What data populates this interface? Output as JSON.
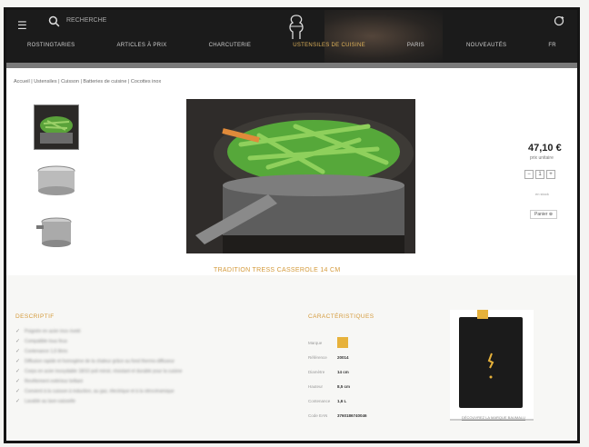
{
  "header": {
    "search_placeholder": "RECHERCHE",
    "nav": [
      "ROSTINGTARIES",
      "ARTICLES À PRIX",
      "CHARCUTERIE",
      "USTENSILES DE CUISINE",
      "PARIS",
      "NOUVEAUTÉS",
      "FR"
    ]
  },
  "breadcrumb": "Accueil | Ustensiles | Cuisson | Batteries de cuisine | Cocottes inox",
  "product": {
    "name": "TRADITION TRESS CASSEROLE 14 CM",
    "price": "47,10 €",
    "price_sub": "prix unitaire",
    "qty": "1",
    "stock": "en stock",
    "cart_label": "Panier ⊕"
  },
  "description": {
    "heading": "DESCRIPTIF",
    "items": [
      "Poignée en acier inox riveté",
      "Compatible tous feux",
      "Contenance 1,6 litres",
      "Diffusion rapide et homogène de la chaleur grâce au fond thermo-diffuseur",
      "Corps en acier inoxydable 18/10 poli miroir, résistant et durable pour la cuisine",
      "Revêtement extérieur brillant",
      "Convient à la cuisson à induction, au gaz, électrique et à la vitrocéramique",
      "Lavable au lave-vaisselle"
    ]
  },
  "specs": {
    "heading": "CARACTÉRISTIQUES",
    "rows": [
      {
        "k": "Marque",
        "v": ""
      },
      {
        "k": "Référence",
        "v": "20014"
      },
      {
        "k": "Diamètre",
        "v": "14 cm"
      },
      {
        "k": "Hauteur",
        "v": "8,5 cm"
      },
      {
        "k": "Contenance",
        "v": "1,6 L"
      },
      {
        "k": "Code EAN",
        "v": "3760186740046"
      }
    ]
  },
  "brand_caption": "DÉCOUVREZ LA MARQUE BAUMALU",
  "colors": {
    "accent": "#d49a3b",
    "brand": "#e7b23b",
    "dark": "#1b1b1b"
  }
}
